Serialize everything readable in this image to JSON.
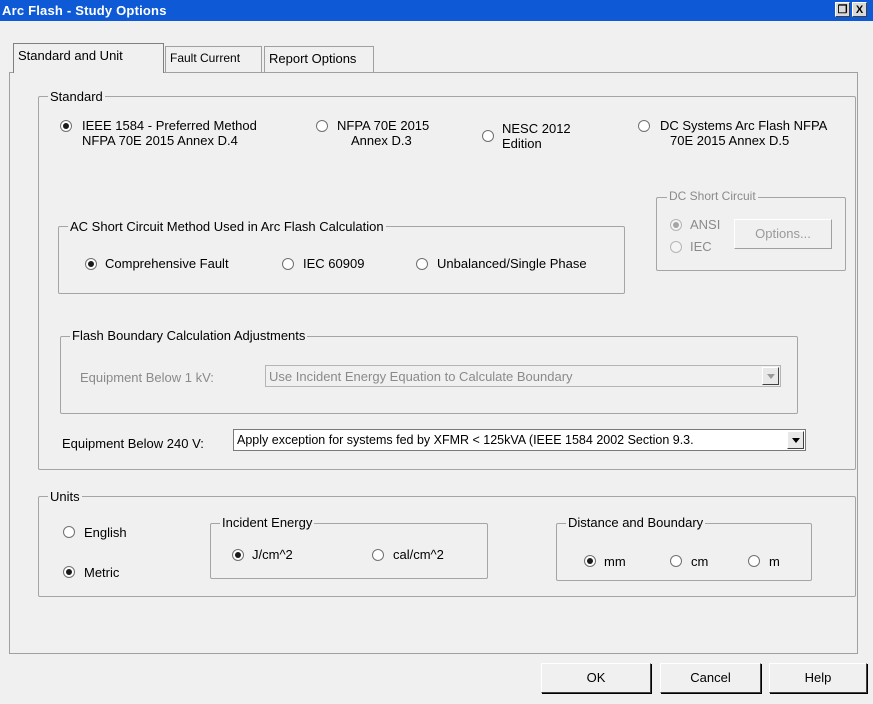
{
  "window": {
    "title": "Arc Flash - Study Options",
    "restore_label": "❐",
    "close_label": "X"
  },
  "tabs": [
    {
      "label": "Standard and Unit"
    },
    {
      "label": "Fault Current"
    },
    {
      "label": "Report Options"
    }
  ],
  "standard": {
    "legend": "Standard",
    "options": [
      {
        "line1": "IEEE 1584 - Preferred Method",
        "line2": "NFPA 70E 2015 Annex D.4",
        "selected": true
      },
      {
        "line1": "NFPA 70E 2015",
        "line2": "Annex D.3",
        "selected": false
      },
      {
        "line1": "NESC 2012",
        "line2": "Edition",
        "selected": false
      },
      {
        "line1": "DC Systems Arc Flash NFPA",
        "line2": "70E 2015 Annex D.5",
        "selected": false
      }
    ],
    "ac_method": {
      "legend": "AC Short Circuit Method Used in Arc Flash Calculation",
      "options": [
        {
          "label": "Comprehensive Fault",
          "selected": true
        },
        {
          "label": "IEC 60909",
          "selected": false
        },
        {
          "label": "Unbalanced/Single Phase",
          "selected": false
        }
      ]
    },
    "dc_short_circuit": {
      "legend": "DC Short Circuit",
      "options": [
        {
          "label": "ANSI",
          "selected": true
        },
        {
          "label": "IEC",
          "selected": false
        }
      ],
      "options_button": "Options..."
    },
    "flash_boundary": {
      "legend": "Flash Boundary Calculation Adjustments",
      "label": "Equipment Below 1 kV:",
      "value": "Use Incident Energy Equation to Calculate Boundary"
    },
    "below_240": {
      "label": "Equipment Below 240 V:",
      "value": "Apply exception for systems fed by XFMR < 125kVA (IEEE 1584 2002 Section 9.3."
    }
  },
  "units": {
    "legend": "Units",
    "system": [
      {
        "label": "English",
        "selected": false
      },
      {
        "label": "Metric",
        "selected": true
      }
    ],
    "incident_energy": {
      "legend": "Incident Energy",
      "options": [
        {
          "label": "J/cm^2",
          "selected": true
        },
        {
          "label": "cal/cm^2",
          "selected": false
        }
      ]
    },
    "distance": {
      "legend": "Distance and Boundary",
      "options": [
        {
          "label": "mm",
          "selected": true
        },
        {
          "label": "cm",
          "selected": false
        },
        {
          "label": "m",
          "selected": false
        }
      ]
    }
  },
  "buttons": {
    "ok": "OK",
    "cancel": "Cancel",
    "help": "Help"
  }
}
